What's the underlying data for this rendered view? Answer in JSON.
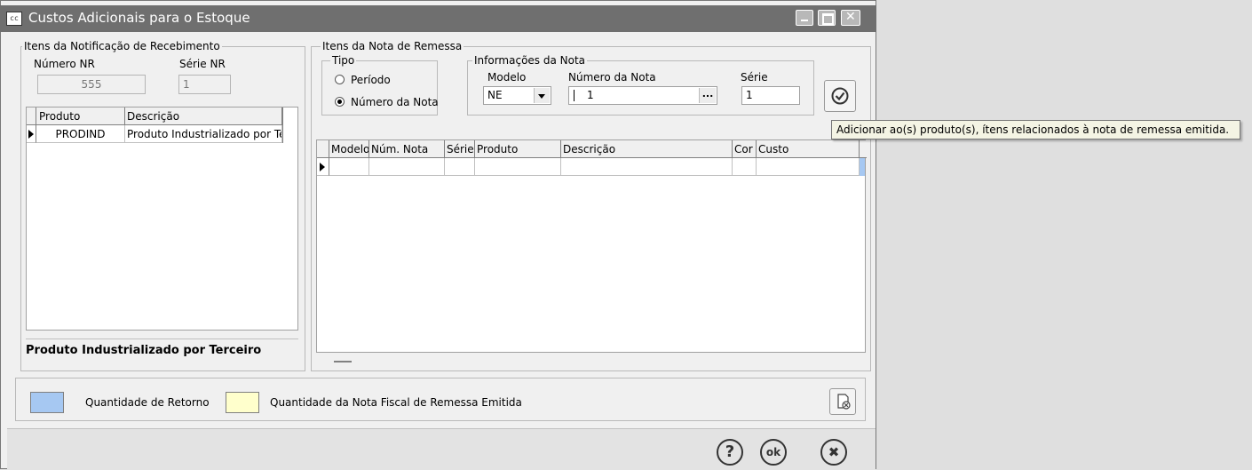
{
  "window": {
    "title": "Custos Adicionais para o Estoque",
    "icon_text": "cc"
  },
  "nr_group": {
    "legend": "Itens da Notificação de Recebimento",
    "numero_label": "Número NR",
    "numero_value": "555",
    "serie_label": "Série NR",
    "serie_value": "1",
    "columns": [
      "Produto",
      "Descrição"
    ],
    "rows": [
      {
        "produto": "PRODIND",
        "descricao": "Produto Industrializado por Ter"
      }
    ],
    "footer_text": "Produto Industrializado por Terceiro"
  },
  "remessa_group": {
    "legend": "Itens da Nota de Remessa",
    "tipo_legend": "Tipo",
    "radio_periodo": "Período",
    "radio_numero": "Número da Nota",
    "info_legend": "Informações da Nota",
    "modelo_label": "Modelo",
    "modelo_value": "NE",
    "numero_nota_label": "Número da Nota",
    "numero_nota_value": "1",
    "serie_label": "Série",
    "serie_value": "1",
    "ellipsis": "...",
    "columns": [
      "Modelo",
      "Núm. Nota",
      "Série",
      "Produto",
      "Descrição",
      "Cor",
      "Custo"
    ]
  },
  "tooltip": "Adicionar ao(s) produto(s), ítens relacionados à nota de remessa emitida.",
  "legend_bar": {
    "retorno_label": "Quantidade de Retorno",
    "retorno_color": "#a6c8f2",
    "remessa_label": "Quantidade da Nota Fiscal de Remessa Emitida",
    "remessa_color": "#ffffcc"
  },
  "footer_buttons": {
    "help": "?",
    "ok": "ok",
    "cancel": "✖"
  },
  "icons": {
    "check": "check-circle-icon",
    "help": "help-icon",
    "ok": "ok-icon",
    "cancel": "cancel-icon",
    "clear": "clear-document-icon"
  }
}
